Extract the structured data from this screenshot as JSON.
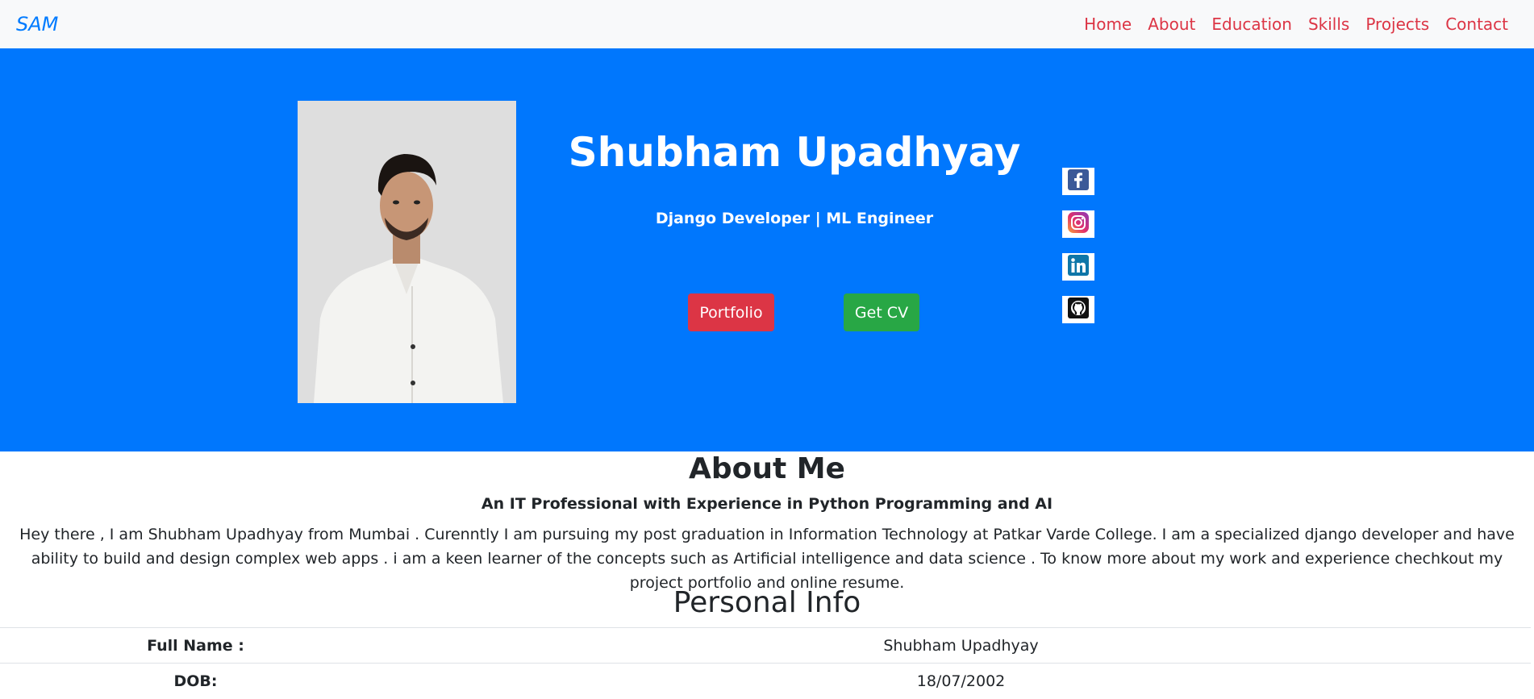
{
  "navbar": {
    "brand": "SAM",
    "links": [
      "Home",
      "About",
      "Education",
      "Skills",
      "Projects",
      "Contact"
    ]
  },
  "hero": {
    "name": "Shubham Upadhyay",
    "tagline": "Django Developer | ML Engineer",
    "portfolio_button": "Portfolio",
    "cv_button": "Get CV",
    "socials": [
      "facebook-icon",
      "instagram-icon",
      "linkedin-icon",
      "github-icon"
    ]
  },
  "about": {
    "title": "About Me",
    "subtitle": "An IT Professional with Experience in Python Programming and AI",
    "text": "Hey there , I am Shubham Upadhyay from Mumbai . Curenntly I am pursuing my post graduation in Information Technology at Patkar Varde College. I am a specialized django developer and have ability to build and design complex web apps . i am a keen learner of the concepts such as Artificial intelligence and data science . To know more about my work and experience chechkout my project portfolio and online resume."
  },
  "personal_info": {
    "title": "Personal Info",
    "rows": [
      {
        "label": "Full Name :",
        "value": "Shubham Upadhyay"
      },
      {
        "label": "DOB:",
        "value": "18/07/2002"
      }
    ]
  },
  "colors": {
    "hero_bg": "#0077fd",
    "nav_link": "#dc3545",
    "brand": "#007bff",
    "portfolio_btn": "#dc3545",
    "cv_btn": "#28a745"
  }
}
